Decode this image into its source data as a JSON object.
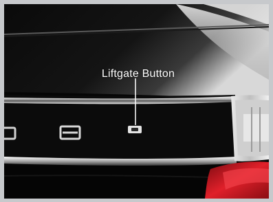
{
  "callout": {
    "label": "Liftgate Button"
  },
  "icons": {
    "button": "liftgate-button-icon"
  }
}
